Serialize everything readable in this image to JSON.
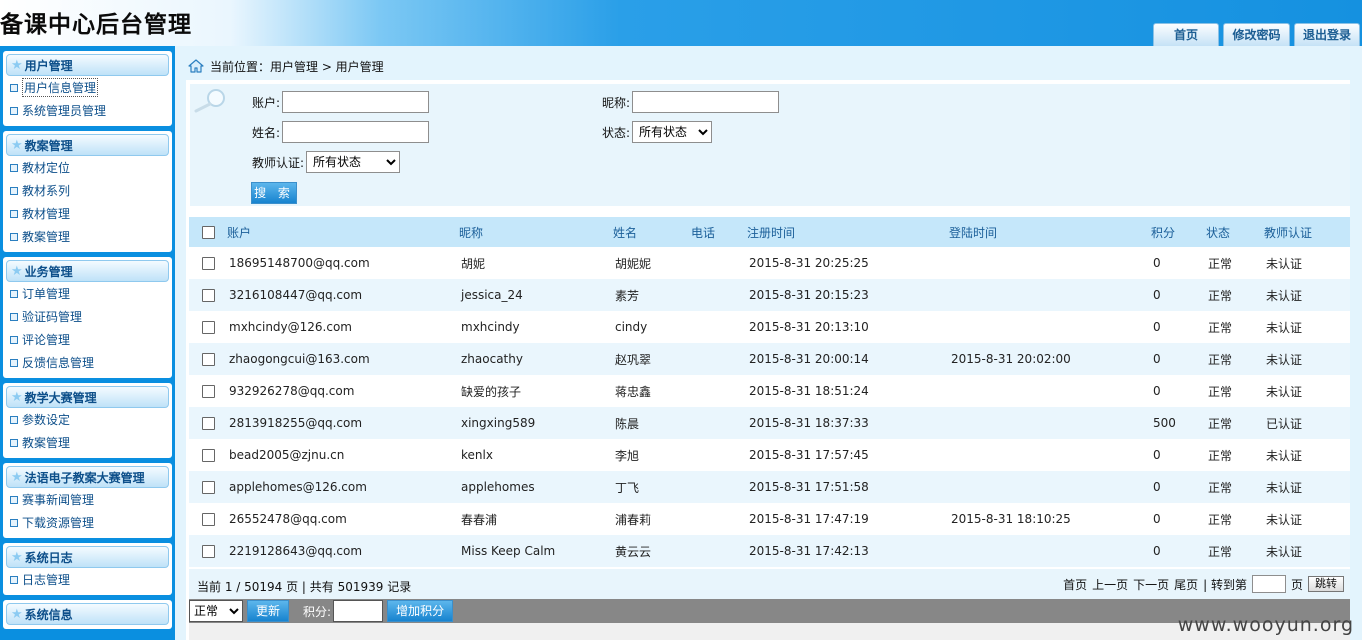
{
  "header": {
    "title": "备课中心后台管理",
    "nav": [
      "首页",
      "修改密码",
      "退出登录"
    ]
  },
  "sidebar": {
    "groups": [
      {
        "title": "用户管理",
        "items": [
          "用户信息管理",
          "系统管理员管理"
        ]
      },
      {
        "title": "教案管理",
        "items": [
          "教材定位",
          "教材系列",
          "教材管理",
          "教案管理"
        ]
      },
      {
        "title": "业务管理",
        "items": [
          "订单管理",
          "验证码管理",
          "评论管理",
          "反馈信息管理"
        ]
      },
      {
        "title": "教学大赛管理",
        "items": [
          "参数设定",
          "教案管理"
        ]
      },
      {
        "title": "法语电子教案大赛管理",
        "items": [
          "赛事新闻管理",
          "下载资源管理"
        ]
      },
      {
        "title": "系统日志",
        "items": [
          "日志管理"
        ]
      },
      {
        "title": "系统信息",
        "items": []
      }
    ]
  },
  "breadcrumb": "当前位置：用户管理 > 用户管理",
  "search": {
    "account_label": "账户:",
    "account_value": "",
    "nickname_label": "昵称:",
    "nickname_value": "",
    "name_label": "姓名:",
    "name_value": "",
    "status_label": "状态:",
    "status_selected": "所有状态",
    "teacher_label": "教师认证:",
    "teacher_selected": "所有状态",
    "search_button": "搜 索"
  },
  "table": {
    "columns": [
      "账户",
      "昵称",
      "姓名",
      "电话",
      "注册时间",
      "登陆时间",
      "积分",
      "状态",
      "教师认证"
    ],
    "rows": [
      [
        "18695148700@qq.com",
        "胡妮",
        "胡妮妮",
        "",
        "2015-8-31 20:25:25",
        "",
        "0",
        "正常",
        "未认证"
      ],
      [
        "3216108447@qq.com",
        "jessica_24",
        "素芳",
        "",
        "2015-8-31 20:15:23",
        "",
        "0",
        "正常",
        "未认证"
      ],
      [
        "mxhcindy@126.com",
        "mxhcindy",
        "cindy",
        "",
        "2015-8-31 20:13:10",
        "",
        "0",
        "正常",
        "未认证"
      ],
      [
        "zhaogongcui@163.com",
        "zhaocathy",
        "赵巩翠",
        "",
        "2015-8-31 20:00:14",
        "2015-8-31 20:02:00",
        "0",
        "正常",
        "未认证"
      ],
      [
        "932926278@qq.com",
        "缺爱的孩子",
        "蒋忠鑫",
        "",
        "2015-8-31 18:51:24",
        "",
        "0",
        "正常",
        "未认证"
      ],
      [
        "2813918255@qq.com",
        "xingxing589",
        "陈晨",
        "",
        "2015-8-31 18:37:33",
        "",
        "500",
        "正常",
        "已认证"
      ],
      [
        "bead2005@zjnu.cn",
        "kenlx",
        "李旭",
        "",
        "2015-8-31 17:57:45",
        "",
        "0",
        "正常",
        "未认证"
      ],
      [
        "applehomes@126.com",
        "applehomes",
        "丁飞",
        "",
        "2015-8-31 17:51:58",
        "",
        "0",
        "正常",
        "未认证"
      ],
      [
        "26552478@qq.com",
        "春春浦",
        "浦春莉",
        "",
        "2015-8-31 17:47:19",
        "2015-8-31 18:10:25",
        "0",
        "正常",
        "未认证"
      ],
      [
        "2219128643@qq.com",
        "Miss Keep Calm",
        "黄云云",
        "",
        "2015-8-31 17:42:13",
        "",
        "0",
        "正常",
        "未认证"
      ]
    ]
  },
  "pager": {
    "summary": "当前 1 / 50194 页 | 共有 501939 记录",
    "first": "首页",
    "prev": "上一页",
    "next": "下一页",
    "last": "尾页",
    "goto_label": "| 转到第",
    "page_unit": "页",
    "jump_button": "跳转"
  },
  "actions": {
    "status_selected": "正常",
    "update_button": "更新",
    "points_label": "积分:",
    "points_value": "",
    "add_points_button": "增加积分"
  },
  "watermark": "www.wooyun.org"
}
